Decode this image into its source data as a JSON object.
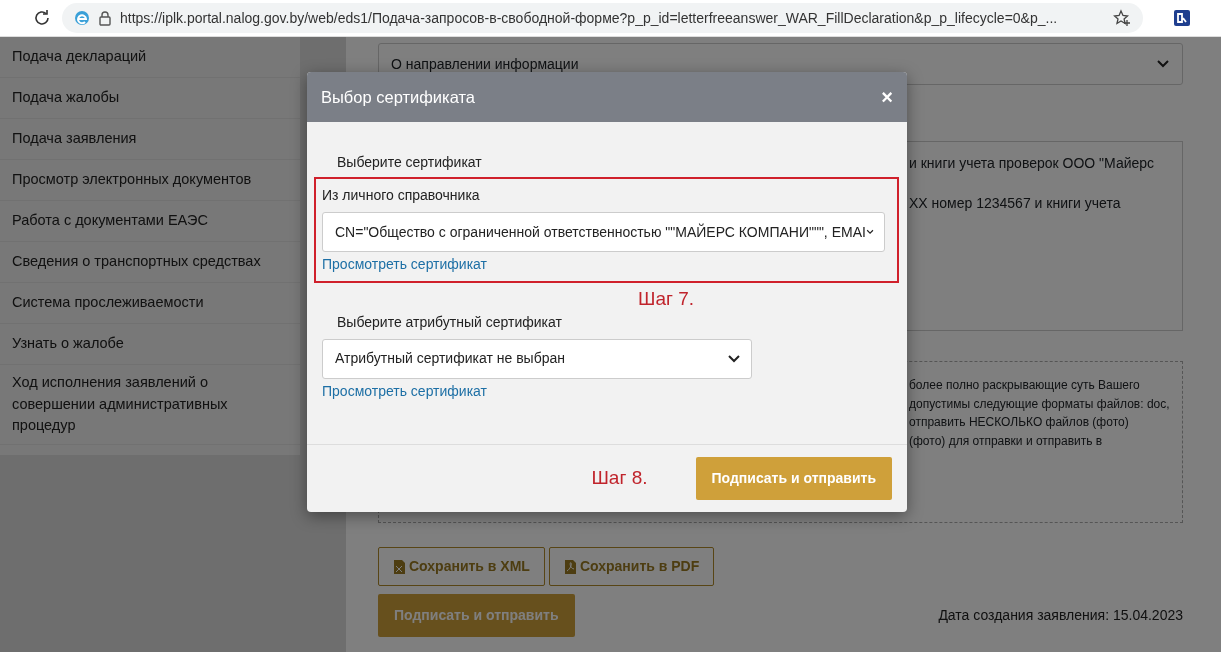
{
  "browser": {
    "url": "https://iplk.portal.nalog.gov.by/web/eds1/Подача-запросов-в-свободной-форме?p_p_id=letterfreeanswer_WAR_FillDeclaration&p_p_lifecycle=0&p_..."
  },
  "sidebar": {
    "items": [
      {
        "label": "Подача деклараций"
      },
      {
        "label": "Подача жалобы"
      },
      {
        "label": "Подача заявления"
      },
      {
        "label": "Просмотр электронных документов"
      },
      {
        "label": "Работа с документами ЕАЭС"
      },
      {
        "label": "Сведения о транспортных средствах"
      },
      {
        "label": "Система прослеживаемости"
      },
      {
        "label": "Узнать о жалобе"
      },
      {
        "label": "Ход исполнения заявлений о совершении административных процедур"
      }
    ]
  },
  "form": {
    "topic_select": {
      "value": "О направлении информации"
    },
    "request_text_lines": [
      "и книги учета проверок ООО \"Майерс",
      "XX номер 1234567 и книги учета"
    ],
    "attachment_note_lines": [
      "более полно раскрывающие суть Вашего",
      "допустимы следующие форматы файлов: doc,",
      "отправить НЕСКОЛЬКО файлов (фото)",
      "(фото) для отправки и отправить в"
    ],
    "save_buttons": [
      {
        "label": "Сохранить в XML",
        "kind": "xml"
      },
      {
        "label": "Сохранить в PDF",
        "kind": "pdf"
      }
    ],
    "submit_button": "Подписать и отправить",
    "created_date": "Дата создания заявления: 15.04.2023"
  },
  "modal": {
    "title": "Выбор сертификата",
    "close": "×",
    "cert_label": "Выберите сертификат",
    "source_label": "Из личного справочника",
    "cert_select": {
      "value": "CN=\"Общество с ограниченной ответственностью \"\"МАЙЕРС КОМПАНИ\"\"\", EMAI"
    },
    "cert_view_link": "Просмотреть сертификат",
    "attr_label": "Выберите атрибутный сертификат",
    "attr_select": {
      "value": "Атрибутный сертификат не выбран"
    },
    "attr_view_link": "Просмотреть сертификат",
    "submit_button": "Подписать и отправить"
  },
  "annotations": [
    {
      "text": "Шаг 7."
    },
    {
      "text": "Шаг 8."
    }
  ]
}
